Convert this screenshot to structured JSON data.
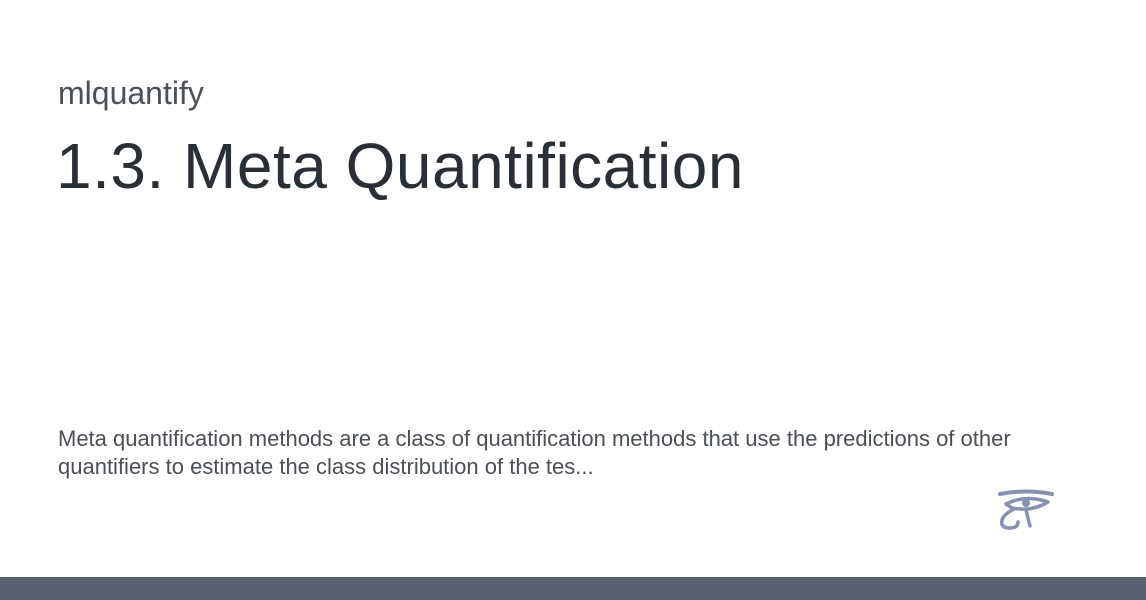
{
  "header": {
    "site_name": "mlquantify",
    "title": "1.3. Meta Quantification"
  },
  "main": {
    "description": "Meta quantification methods are a class of quantification methods that use the predictions of other quantifiers to estimate the class distribution of the tes..."
  },
  "logo": {
    "icon": "eye-of-horus-icon",
    "color": "#8891b0"
  },
  "footer": {
    "bar_color": "#5b6170"
  }
}
